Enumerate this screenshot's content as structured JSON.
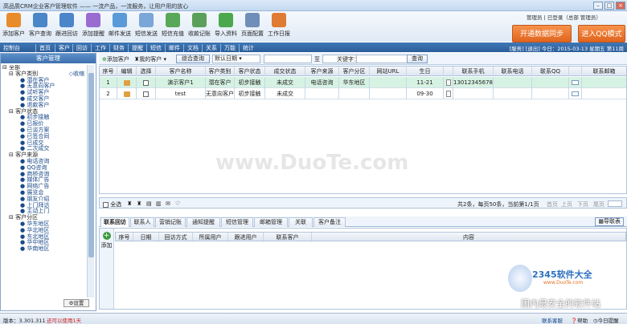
{
  "app": {
    "title": "高品质CRM企业客户管理软件 —— 一流产品，一流服务，让用户用的放心"
  },
  "toolbar": {
    "buttons": [
      {
        "label": "添加客户",
        "icon": "user-add-icon",
        "color": "#e88b2a"
      },
      {
        "label": "客户查询",
        "icon": "user-search-icon",
        "color": "#4b86c8"
      },
      {
        "label": "跟进回访",
        "icon": "follow-up-icon",
        "color": "#4b86c8"
      },
      {
        "label": "添加提醒",
        "icon": "reminder-icon",
        "color": "#9a6bd0"
      },
      {
        "label": "邮件发送",
        "icon": "mail-icon",
        "color": "#5a9ad8"
      },
      {
        "label": "短信发送",
        "icon": "sms-icon",
        "color": "#7aa7d8"
      },
      {
        "label": "短信充值",
        "icon": "sms-recharge-icon",
        "color": "#58a858"
      },
      {
        "label": "收款记账",
        "icon": "payment-icon",
        "color": "#5aa05a"
      },
      {
        "label": "导入资料",
        "icon": "import-icon",
        "color": "#4ca84c"
      },
      {
        "label": "页面配置",
        "icon": "page-config-icon",
        "color": "#6f8fb8"
      },
      {
        "label": "工作日报",
        "icon": "daily-report-icon",
        "color": "#e07b34"
      }
    ],
    "user_info": "管理员 | 已登录（总部 管理员）",
    "btn_open": "开通数据同步",
    "btn_qq": "进入QQ模式"
  },
  "nav": {
    "items": [
      "控制台",
      "首页",
      "客户",
      "回访",
      "工作",
      "财务",
      "提醒",
      "短信",
      "邮件",
      "文档",
      "关系",
      "万能",
      "统计"
    ],
    "right": "[服务] [退出] 今日：2015-03-13 星期五 第11周"
  },
  "sidebar": {
    "header": "客户管理",
    "collapse": "收缩",
    "all": "全部",
    "groups": [
      {
        "title": "客户类别",
        "items": [
          "潜在客户",
          "无意向客户",
          "试听客户",
          "成交客户",
          "退款客户"
        ]
      },
      {
        "title": "客户状态",
        "items": [
          "初步接触",
          "已报价",
          "已谈方案",
          "已签合同",
          "已成交",
          "二次成交"
        ]
      },
      {
        "title": "客户来源",
        "items": [
          "电话咨询",
          "QQ咨询",
          "商桥咨询",
          "媒体广告",
          "网络广告",
          "展览会",
          "朋友介绍",
          "上门拜访",
          "主动上门"
        ]
      },
      {
        "title": "客户分区",
        "items": [
          "华东地区",
          "华北地区",
          "东北地区",
          "华中地区",
          "华南地区"
        ]
      }
    ],
    "settings": "设置"
  },
  "search": {
    "add": "添加客户",
    "mine": "我的客户",
    "combo": "综合查询",
    "date_field": "默认日期",
    "to": "至",
    "keyword": "关键字：",
    "query": "查询"
  },
  "grid": {
    "columns": [
      "序号",
      "编辑",
      "选择",
      "客户名称",
      "客户类别",
      "客户状态",
      "成交状态",
      "客户来源",
      "客户分区",
      "网站URL",
      "生日",
      "",
      "联系手机",
      "联系电话",
      "联系QQ",
      "",
      "联系邮箱"
    ],
    "rows": [
      {
        "no": "1",
        "name": "演示客户1",
        "category": "潜在客户",
        "status": "初步接触",
        "deal": "未成交",
        "source": "电话咨询",
        "region": "华东地区",
        "url": "",
        "birthday": "11-21",
        "mobile": "13012345678",
        "phone": "",
        "qq": "",
        "email": ""
      },
      {
        "no": "2",
        "name": "test",
        "category": "无意向客户",
        "status": "初步接触",
        "deal": "未成交",
        "source": "",
        "region": "",
        "url": "",
        "birthday": "09-30",
        "mobile": "",
        "phone": "",
        "qq": "",
        "email": ""
      }
    ],
    "select_all": "全选",
    "pager": "共2条，每页50条，当前第1/1页",
    "pager_btns": [
      "首页",
      "上页",
      "下页",
      "尾页"
    ]
  },
  "tabs": {
    "items": [
      "联系回访",
      "联系人",
      "营销记账",
      "通知提醒",
      "短信管理",
      "邮箱管理",
      "关联",
      "客户备注"
    ],
    "export": "导联表"
  },
  "sub": {
    "add": "添加",
    "columns": [
      "序号",
      "日期",
      "回访方式",
      "所属用户",
      "跟进用户",
      "联系客户",
      "内容"
    ]
  },
  "status": {
    "version": "版本：3.301.311",
    "trial": "还可以使用1天",
    "service": "联系客服",
    "help": "帮助",
    "reminder": "今日提醒"
  },
  "watermark": {
    "main": "www.DuoTe.com",
    "brand": "2345软件大全",
    "url": "www.DuoTe.com",
    "slogan": "国内最安全的软件站"
  }
}
